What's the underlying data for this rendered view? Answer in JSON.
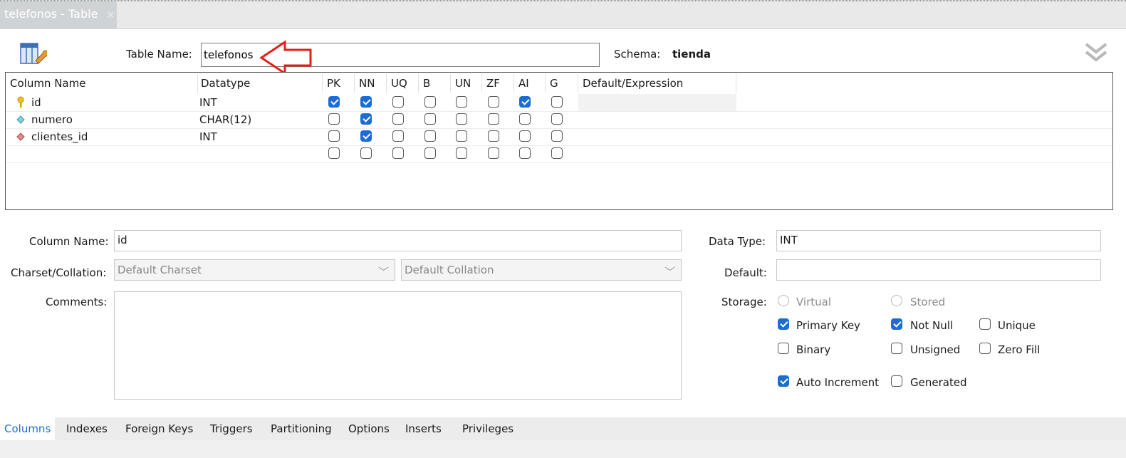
{
  "tab": {
    "title": "telefonos - Table",
    "close": "×"
  },
  "header": {
    "table_name_label": "Table Name:",
    "table_name_value": "telefonos",
    "schema_label": "Schema:",
    "schema_value": "tienda",
    "icon": "table-wrench-icon",
    "collapse_icon": "double-chevron-down-icon",
    "annotation_arrow_color": "#e0201a"
  },
  "grid": {
    "headers": [
      "Column Name",
      "Datatype",
      "PK",
      "NN",
      "UQ",
      "B",
      "UN",
      "ZF",
      "AI",
      "G",
      "Default/Expression"
    ],
    "rows": [
      {
        "name": "id",
        "type": "INT",
        "icon": "primary-key-icon",
        "flags": [
          true,
          true,
          false,
          false,
          false,
          false,
          true,
          false
        ]
      },
      {
        "name": "numero",
        "type": "CHAR(12)",
        "icon": "column-diamond-icon",
        "flags": [
          false,
          true,
          false,
          false,
          false,
          false,
          false,
          false
        ]
      },
      {
        "name": "clientes_id",
        "type": "INT",
        "icon": "foreign-key-diamond-icon",
        "flags": [
          false,
          true,
          false,
          false,
          false,
          false,
          false,
          false
        ]
      },
      {
        "name": "",
        "type": "",
        "icon": "",
        "flags": [
          false,
          false,
          false,
          false,
          false,
          false,
          false,
          false
        ]
      }
    ]
  },
  "details": {
    "column_name_label": "Column Name:",
    "column_name_value": "id",
    "charset_label": "Charset/Collation:",
    "charset_value": "Default Charset",
    "collation_value": "Default Collation",
    "comments_label": "Comments:",
    "data_type_label": "Data Type:",
    "data_type_value": "INT",
    "default_label": "Default:",
    "storage_label": "Storage:",
    "virtual_label": "Virtual",
    "stored_label": "Stored",
    "primary_key_label": "Primary Key",
    "not_null_label": "Not Null",
    "unique_label": "Unique",
    "binary_label": "Binary",
    "unsigned_label": "Unsigned",
    "zero_fill_label": "Zero Fill",
    "auto_increment_label": "Auto Increment",
    "generated_label": "Generated",
    "checks": {
      "primary_key": true,
      "not_null": true,
      "unique": false,
      "binary": false,
      "unsigned": false,
      "zero_fill": false,
      "auto_increment": true,
      "generated": false
    }
  },
  "bottom_tabs": [
    "Columns",
    "Indexes",
    "Foreign Keys",
    "Triggers",
    "Partitioning",
    "Options",
    "Inserts",
    "Privileges"
  ],
  "accent_color": "#1d6cd3"
}
